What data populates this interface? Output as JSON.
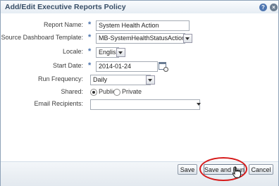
{
  "dialog": {
    "title": "Add/Edit Executive Reports Policy",
    "icons": [
      "help-icon",
      "close-icon"
    ]
  },
  "form": {
    "report_name": {
      "label": "Report Name:",
      "value": "System Health Action",
      "required": true
    },
    "source_template": {
      "label": "Source Dashboard Template:",
      "value": "MB-SystemHealthStatusAction",
      "required": true
    },
    "locale": {
      "label": "Locale:",
      "value": "English",
      "required": true
    },
    "start_date": {
      "label": "Start Date:",
      "value": "2014-01-24",
      "required": true
    },
    "run_frequency": {
      "label": "Run Frequency:",
      "value": "Daily"
    },
    "shared": {
      "label": "Shared:",
      "options": [
        "Public",
        "Private"
      ],
      "selected": "Public"
    },
    "email_recipients": {
      "label": "Email Recipients:",
      "value": ""
    },
    "required_marker": "*"
  },
  "footer": {
    "save_label": "Save",
    "save_and_run_label": "Save and Run",
    "cancel_label": "Cancel"
  },
  "colors": {
    "title": "#384e66",
    "required_marker": "#4c74ad",
    "highlight": "#d61a1a"
  }
}
